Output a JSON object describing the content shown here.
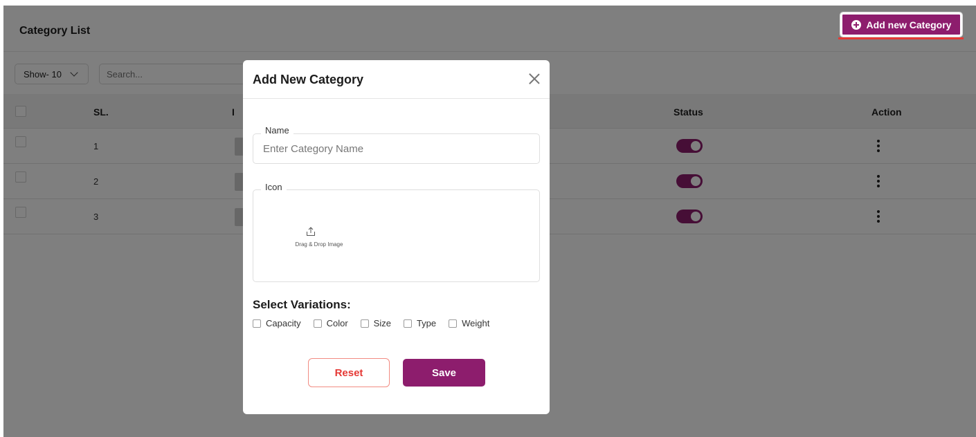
{
  "header": {
    "title": "Category List",
    "add_button_label": "Add new Category"
  },
  "toolbar": {
    "show_label": "Show- 10",
    "search_placeholder": "Search..."
  },
  "table": {
    "columns": {
      "sl": "SL.",
      "icon": "I",
      "status": "Status",
      "action": "Action"
    },
    "rows": [
      {
        "sl": "1",
        "status_on": true
      },
      {
        "sl": "2",
        "status_on": true
      },
      {
        "sl": "3",
        "status_on": true
      }
    ]
  },
  "modal": {
    "title": "Add New Category",
    "name_label": "Name",
    "name_placeholder": "Enter Category Name",
    "icon_label": "Icon",
    "dropzone_text": "Drag & Drop Image",
    "variations_title": "Select Variations:",
    "variations": [
      "Capacity",
      "Color",
      "Size",
      "Type",
      "Weight"
    ],
    "reset_label": "Reset",
    "save_label": "Save"
  },
  "colors": {
    "accent": "#8d1d6d",
    "danger": "#e53935",
    "overlay": "rgba(0,0,0,0.5)"
  }
}
